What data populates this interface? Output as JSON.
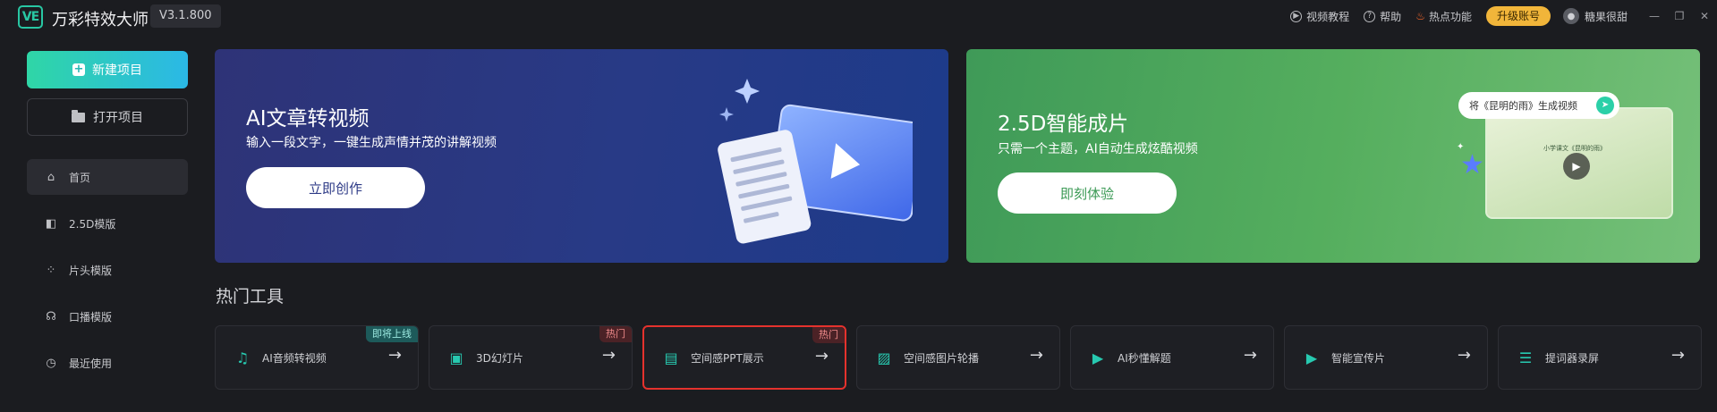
{
  "app": {
    "logo_text": "VE",
    "title": "万彩特效大师",
    "version": "V3.1.800"
  },
  "topbar": {
    "video_tutorial": "视频教程",
    "help": "帮助",
    "hot_features": "热点功能",
    "upgrade": "升级账号",
    "username": "糖果很甜"
  },
  "sidebar": {
    "new_project": "新建项目",
    "open_project": "打开项目",
    "items": [
      {
        "label": "首页",
        "icon": "home-icon"
      },
      {
        "label": "2.5D模版",
        "icon": "cube-icon"
      },
      {
        "label": "片头模版",
        "icon": "grid-icon"
      },
      {
        "label": "口播模版",
        "icon": "presenter-icon"
      },
      {
        "label": "最近使用",
        "icon": "clock-icon"
      }
    ]
  },
  "banners": [
    {
      "title": "AI文章转视频",
      "subtitle": "输入一段文字，一键生成声情并茂的讲解视频",
      "button": "立即创作"
    },
    {
      "title": "2.5D智能成片",
      "subtitle": "只需一个主题，AI自动生成炫酷视频",
      "button": "即刻体验",
      "preview_caption": "将《昆明的雨》生成视频",
      "preview_inner": "小学课文《昆明的雨》"
    }
  ],
  "hot_tools": {
    "title": "热门工具",
    "items": [
      {
        "label": "AI音频转视频",
        "badge": "即将上线",
        "badge_type": "soon"
      },
      {
        "label": "3D幻灯片",
        "badge": "热门",
        "badge_type": "hot"
      },
      {
        "label": "空间感PPT展示",
        "badge": "热门",
        "badge_type": "hot"
      },
      {
        "label": "空间感图片轮播",
        "badge": "",
        "badge_type": ""
      },
      {
        "label": "AI秒懂解题",
        "badge": "",
        "badge_type": ""
      },
      {
        "label": "智能宣传片",
        "badge": "",
        "badge_type": ""
      },
      {
        "label": "提词器录屏",
        "badge": "",
        "badge_type": ""
      }
    ]
  },
  "colors": {
    "accent": "#28c7a3",
    "upgrade": "#f1b53a",
    "selected_border": "#e5322d"
  }
}
